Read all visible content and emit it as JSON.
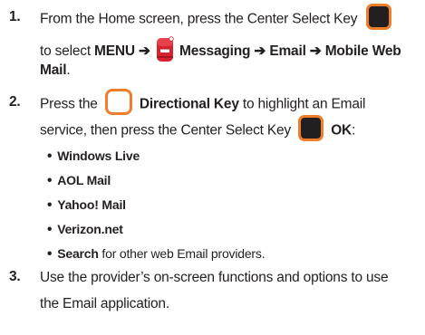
{
  "steps": [
    {
      "number": "1.",
      "line1_text": "From the Home screen, press the Center Select Key",
      "line2_prefix": "to select ",
      "menu": "MENU",
      "arrow1": "➔",
      "messaging": "Messaging",
      "arrow2": "➔",
      "email": "Email",
      "arrow3": "➔",
      "mobile_web": "Mobile Web",
      "line3_bold": "Mail",
      "line3_suffix": "."
    },
    {
      "number": "2.",
      "line1_prefix": "Press the",
      "directional_key": "Directional Key",
      "line1_suffix": "to highlight an Email",
      "line2_text": "service, then press the Center Select Key",
      "ok": "OK",
      "ok_suffix": ":"
    },
    {
      "number": "3.",
      "line1_text": "Use the provider’s on-screen functions and options to use",
      "line2_text": "the Email application."
    }
  ],
  "bullets": [
    {
      "bold": "Windows Live",
      "rest": ""
    },
    {
      "bold": "AOL Mail",
      "rest": ""
    },
    {
      "bold": "Yahoo! Mail",
      "rest": ""
    },
    {
      "bold": "Verizon.net",
      "rest": ""
    },
    {
      "bold": "Search",
      "rest": " for other web Email providers."
    }
  ],
  "bullet_glyph": "•",
  "icons": {
    "center_select_key": "center-select-key-icon",
    "directional_key": "directional-key-icon",
    "messaging": "mailbox-icon"
  },
  "colors": {
    "key_border": "#f07d2a",
    "key_fill": "#231f20",
    "mailbox_red": "#d7232f",
    "text": "#231f20"
  }
}
